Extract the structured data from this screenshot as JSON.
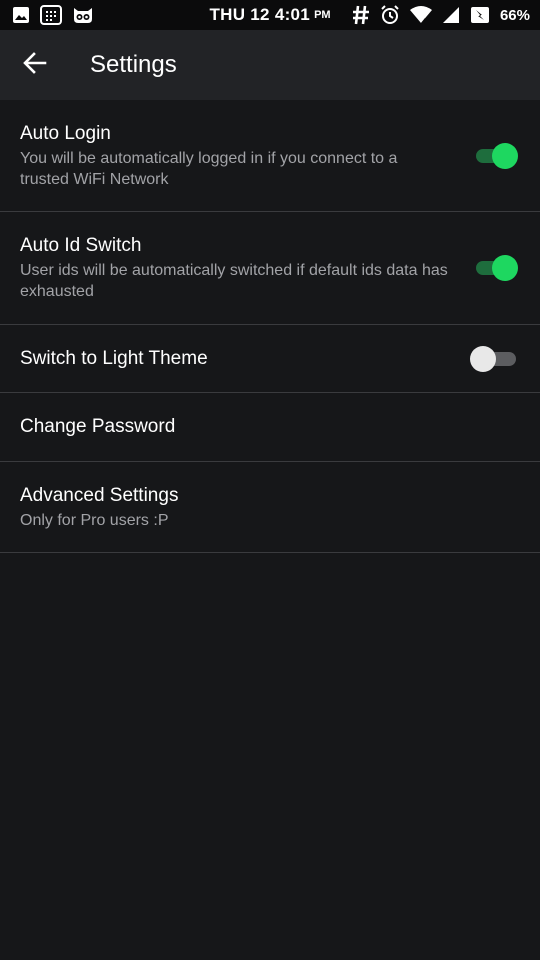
{
  "status_bar": {
    "time": "THU 12 4:01",
    "ampm": "PM",
    "battery_percent": "66%",
    "icons_left": [
      "image-icon",
      "calendar-icon",
      "cat-face-icon"
    ],
    "icons_right": [
      "hash-icon",
      "alarm-icon",
      "wifi-icon",
      "signal-icon",
      "battery-icon"
    ]
  },
  "app_bar": {
    "back_icon": "arrow-left-icon",
    "title": "Settings"
  },
  "settings": {
    "items": [
      {
        "title": "Auto Login",
        "summary": "You will be automatically logged in if you connect to a trusted WiFi Network",
        "toggle": true
      },
      {
        "title": "Auto Id Switch",
        "summary": "User ids will be automatically switched if default ids data has exhausted",
        "toggle": true
      },
      {
        "title": "Switch to Light Theme",
        "toggle": false
      },
      {
        "title": "Change Password"
      },
      {
        "title": "Advanced Settings",
        "summary": "Only for Pro users :P"
      }
    ]
  },
  "colors": {
    "background": "#161719",
    "app_bar": "#222326",
    "status_bar": "#0b0b0c",
    "accent_green": "#1ed760",
    "divider": "#3a3b3e",
    "summary_text": "#a2a3a7"
  }
}
